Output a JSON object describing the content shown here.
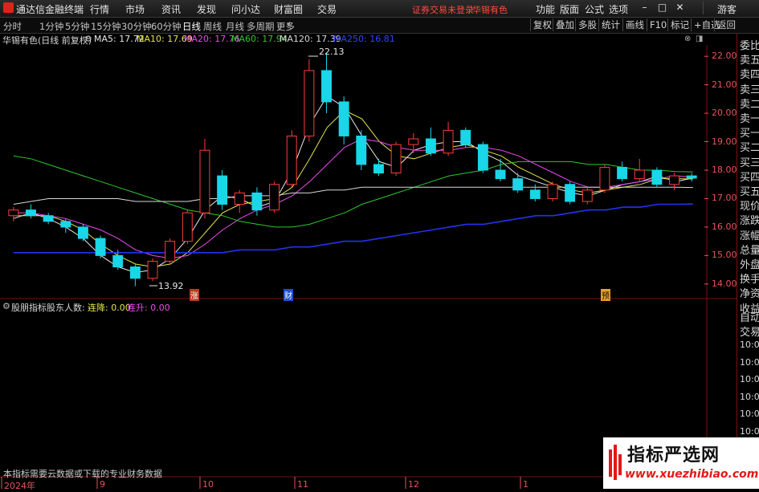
{
  "app": {
    "title": "通达信金融终端"
  },
  "menu": {
    "items": [
      "行情",
      "市场",
      "资讯",
      "发现",
      "问小达",
      "财富圈",
      "交易"
    ],
    "login_status": "证券交易未登录",
    "stock_tag": "华锡有色",
    "right_items": [
      "功能",
      "版面",
      "公式",
      "选项"
    ],
    "guest": "游客"
  },
  "periods": {
    "items": [
      "分时",
      "1分钟",
      "5分钟",
      "15分钟",
      "30分钟",
      "60分钟",
      "日线",
      "周线",
      "月线",
      "多周期",
      "更多"
    ],
    "active": "日线"
  },
  "toolbar_right": [
    "复权",
    "叠加",
    "多股",
    "统计",
    "画线",
    "F10",
    "标记",
    "+自选",
    "返回"
  ],
  "chart_header": {
    "stock": "华锡有色(日线 前复权)",
    "ma5": "MA5: 17.72",
    "ma10": "MA10: 17.69",
    "ma20": "MA20: 17.76",
    "ma60": "MA60: 17.94",
    "ma120": "MA120: 17.39",
    "ma250": "MA250: 16.81"
  },
  "colors": {
    "up": "#ff3b3b",
    "down": "#19d6e8",
    "ma5": "#e8e8e8",
    "ma10": "#e6e64a",
    "ma20": "#ee4aee",
    "ma60": "#2ec82e",
    "ma120": "#d8d8d8",
    "ma250": "#2233ee",
    "axis": "#e8545a"
  },
  "chart_data": {
    "type": "line",
    "title": "华锡有色(日线 前复权)",
    "xlabel": "",
    "ylabel": "",
    "ylim": [
      13.6,
      22.4
    ],
    "y_ticks": [
      14.0,
      15.0,
      16.0,
      17.0,
      18.0,
      19.0,
      20.0,
      21.0,
      22.0
    ],
    "x_ticks": [
      "2024年",
      "9",
      "10",
      "11",
      "12",
      "1"
    ],
    "annotations": {
      "high": "22.13",
      "low": "13.92"
    },
    "markers": [
      "涨",
      "财",
      "预"
    ],
    "series": [
      {
        "name": "MA5",
        "values": [
          16.3,
          16.5,
          16.3,
          16.0,
          15.6,
          15.0,
          14.6,
          14.4,
          14.5,
          14.9,
          15.6,
          16.6,
          17.1,
          17.0,
          16.7,
          16.9,
          18.0,
          19.6,
          20.6,
          20.2,
          19.2,
          18.3,
          18.1,
          18.7,
          18.9,
          19.0,
          19.0,
          18.6,
          18.3,
          17.8,
          17.6,
          17.4,
          17.2,
          17.1,
          17.3,
          17.5,
          17.6,
          17.8,
          17.6,
          17.72
        ]
      },
      {
        "name": "MA10",
        "values": [
          16.4,
          16.4,
          16.4,
          16.2,
          15.9,
          15.4,
          15.0,
          14.7,
          14.6,
          14.7,
          15.1,
          15.8,
          16.5,
          16.8,
          16.9,
          17.0,
          17.4,
          18.4,
          19.5,
          20.1,
          19.8,
          19.0,
          18.5,
          18.4,
          18.6,
          18.8,
          18.9,
          18.7,
          18.5,
          18.1,
          17.8,
          17.5,
          17.3,
          17.2,
          17.3,
          17.4,
          17.5,
          17.7,
          17.7,
          17.69
        ]
      },
      {
        "name": "MA20",
        "values": [
          16.5,
          16.5,
          16.4,
          16.3,
          16.1,
          15.9,
          15.6,
          15.2,
          15.0,
          14.9,
          15.0,
          15.4,
          15.9,
          16.3,
          16.6,
          16.8,
          17.1,
          17.6,
          18.2,
          18.8,
          19.1,
          19.0,
          18.8,
          18.7,
          18.7,
          18.7,
          18.8,
          18.8,
          18.7,
          18.5,
          18.2,
          17.9,
          17.6,
          17.4,
          17.4,
          17.5,
          17.6,
          17.7,
          17.8,
          17.76
        ]
      },
      {
        "name": "MA60",
        "values": [
          18.5,
          18.4,
          18.2,
          18.0,
          17.8,
          17.6,
          17.4,
          17.2,
          17.0,
          16.8,
          16.6,
          16.5,
          16.4,
          16.2,
          16.1,
          16.0,
          16.0,
          16.1,
          16.3,
          16.5,
          16.8,
          17.0,
          17.2,
          17.4,
          17.6,
          17.8,
          17.9,
          18.0,
          18.2,
          18.3,
          18.3,
          18.3,
          18.3,
          18.2,
          18.2,
          18.1,
          18.0,
          18.0,
          17.95,
          17.94
        ]
      },
      {
        "name": "MA120",
        "values": [
          16.8,
          16.9,
          17.0,
          17.0,
          17.0,
          17.0,
          17.0,
          16.9,
          16.9,
          16.9,
          16.9,
          17.0,
          17.0,
          17.1,
          17.1,
          17.1,
          17.2,
          17.2,
          17.3,
          17.3,
          17.4,
          17.4,
          17.4,
          17.4,
          17.4,
          17.4,
          17.4,
          17.4,
          17.4,
          17.4,
          17.4,
          17.4,
          17.4,
          17.4,
          17.4,
          17.4,
          17.4,
          17.4,
          17.4,
          17.39
        ]
      },
      {
        "name": "MA250",
        "values": [
          15.1,
          15.1,
          15.1,
          15.1,
          15.1,
          15.1,
          15.1,
          15.1,
          15.1,
          15.1,
          15.1,
          15.1,
          15.1,
          15.2,
          15.2,
          15.2,
          15.3,
          15.3,
          15.4,
          15.5,
          15.5,
          15.6,
          15.7,
          15.8,
          15.9,
          16.0,
          16.1,
          16.1,
          16.2,
          16.3,
          16.4,
          16.4,
          16.5,
          16.6,
          16.6,
          16.7,
          16.7,
          16.8,
          16.8,
          16.81
        ]
      }
    ],
    "candles": [
      [
        16.4,
        16.7,
        16.2,
        16.6
      ],
      [
        16.6,
        16.8,
        16.3,
        16.4
      ],
      [
        16.4,
        16.5,
        16.1,
        16.2
      ],
      [
        16.2,
        16.3,
        15.8,
        16.0
      ],
      [
        16.0,
        16.1,
        15.5,
        15.6
      ],
      [
        15.6,
        15.7,
        14.9,
        15.0
      ],
      [
        15.0,
        15.2,
        14.5,
        14.6
      ],
      [
        14.6,
        14.7,
        13.92,
        14.2
      ],
      [
        14.2,
        14.9,
        14.1,
        14.8
      ],
      [
        14.8,
        15.6,
        14.7,
        15.5
      ],
      [
        15.5,
        16.6,
        15.4,
        16.5
      ],
      [
        16.5,
        19.1,
        16.3,
        18.7
      ],
      [
        17.8,
        18.0,
        16.6,
        16.8
      ],
      [
        16.8,
        17.3,
        16.5,
        17.2
      ],
      [
        17.2,
        17.4,
        16.4,
        16.6
      ],
      [
        16.6,
        17.6,
        16.5,
        17.5
      ],
      [
        17.5,
        19.4,
        17.4,
        19.2
      ],
      [
        19.2,
        21.9,
        19.0,
        21.5
      ],
      [
        21.5,
        22.13,
        20.0,
        20.4
      ],
      [
        20.4,
        20.6,
        18.9,
        19.2
      ],
      [
        19.2,
        19.4,
        18.0,
        18.2
      ],
      [
        18.2,
        18.4,
        17.8,
        17.9
      ],
      [
        17.9,
        19.0,
        17.8,
        18.9
      ],
      [
        18.9,
        19.3,
        18.6,
        19.1
      ],
      [
        19.1,
        19.5,
        18.5,
        18.6
      ],
      [
        18.6,
        19.7,
        18.5,
        19.4
      ],
      [
        19.4,
        19.5,
        18.8,
        18.9
      ],
      [
        18.9,
        19.0,
        17.9,
        18.0
      ],
      [
        18.0,
        18.4,
        17.6,
        17.7
      ],
      [
        17.7,
        17.9,
        17.2,
        17.3
      ],
      [
        17.3,
        17.5,
        16.9,
        17.0
      ],
      [
        17.0,
        17.6,
        16.9,
        17.5
      ],
      [
        17.5,
        17.6,
        16.8,
        16.9
      ],
      [
        16.9,
        17.4,
        16.8,
        17.3
      ],
      [
        17.3,
        18.2,
        17.2,
        18.1
      ],
      [
        18.1,
        18.3,
        17.6,
        17.7
      ],
      [
        17.7,
        18.4,
        17.6,
        18.0
      ],
      [
        18.0,
        18.1,
        17.4,
        17.5
      ],
      [
        17.5,
        17.9,
        17.3,
        17.8
      ],
      [
        17.8,
        17.9,
        17.6,
        17.72
      ]
    ]
  },
  "indicator": {
    "name": "股朋指标",
    "param": "股东人数: -",
    "down": "连降: 0.00",
    "up": "连升: 0.00",
    "note": "本指标需要云数据或下载的专业财务数据"
  },
  "right_panel": {
    "labels": [
      "委比",
      "卖五",
      "卖四",
      "卖三",
      "卖二",
      "卖一",
      "买一",
      "买二",
      "买三",
      "买四",
      "买五",
      "现价",
      "涨跌",
      "涨幅",
      "总量",
      "外盘",
      "换手",
      "净资",
      "收益"
    ],
    "trade_labels": [
      "自动",
      "交易"
    ],
    "times": [
      "10:09",
      "10:09",
      "10:09",
      "10:09",
      "10:09",
      "10:09",
      "10:1"
    ]
  },
  "watermark": {
    "title": "指标严选网",
    "url": "www.xuezhibiao.com"
  }
}
